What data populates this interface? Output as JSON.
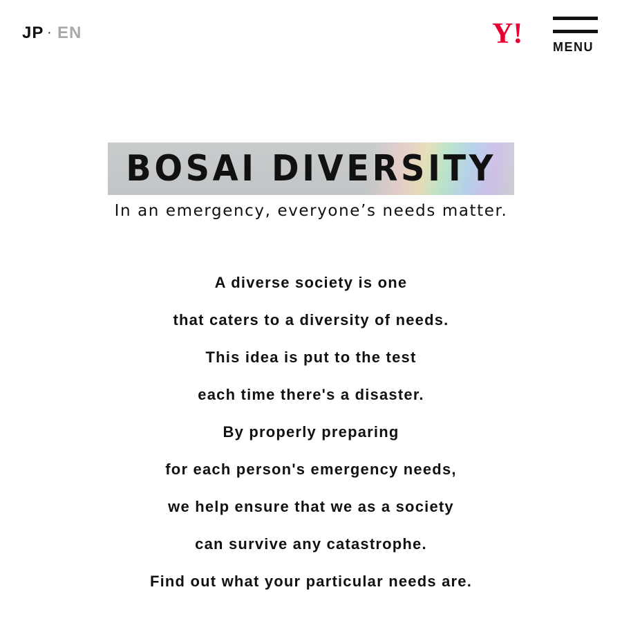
{
  "header": {
    "lang_jp": "JP",
    "lang_separator": "·",
    "lang_en": "EN",
    "logo_text": "Y!",
    "logo_color": "#e60033",
    "menu_label": "MENU"
  },
  "hero": {
    "title": "BOSAI DIVERSITY",
    "tagline": "In an emergency, everyone’s needs matter."
  },
  "body": {
    "lines": [
      "A diverse society is one",
      "that caters to a diversity of needs.",
      "This idea is put to the test",
      "each time there's a disaster.",
      "By properly preparing",
      "for each person's emergency needs,",
      "we help ensure that we as a society",
      "can survive any catastrophe.",
      "Find out what your particular needs are."
    ]
  },
  "colors": {
    "text": "#111111",
    "inactive_lang": "#a8a8a8",
    "background": "#ffffff"
  }
}
